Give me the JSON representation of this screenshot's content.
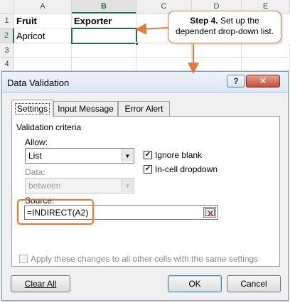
{
  "spreadsheet": {
    "columns": [
      "A",
      "B",
      "C",
      "D",
      "E"
    ],
    "rows": [
      "1",
      "2",
      "3",
      "4"
    ],
    "cells": {
      "A1": "Fruit",
      "B1": "Exporter",
      "A2": "Apricot"
    },
    "active_cell": "B2"
  },
  "callout": {
    "step": "Step 4.",
    "text": " Set up the dependent drop-down list."
  },
  "dialog": {
    "title": "Data Validation",
    "help_button": "?",
    "close_button": "✕",
    "tabs": [
      {
        "label": "Settings",
        "active": true
      },
      {
        "label": "Input Message",
        "active": false
      },
      {
        "label": "Error Alert",
        "active": false
      }
    ],
    "section_title": "Validation criteria",
    "allow_label": "Allow:",
    "allow_value": "List",
    "data_label": "Data:",
    "data_value": "between",
    "ignore_blank_label": "Ignore blank",
    "ignore_blank_checked": true,
    "in_cell_dropdown_label": "In-cell dropdown",
    "in_cell_dropdown_checked": true,
    "source_label": "Source:",
    "source_value": "=INDIRECT(A2)",
    "apply_all_label": "Apply these changes to all other cells with the same settings",
    "apply_all_checked": false,
    "clear_all_button": "Clear All",
    "ok_button": "OK",
    "cancel_button": "Cancel"
  },
  "colors": {
    "accent_orange": "#e07b39",
    "excel_green": "#217346"
  },
  "icons": {
    "help": "question-icon",
    "close": "close-icon",
    "dropdown": "chevron-down-icon",
    "range_picker": "range-select-icon"
  }
}
